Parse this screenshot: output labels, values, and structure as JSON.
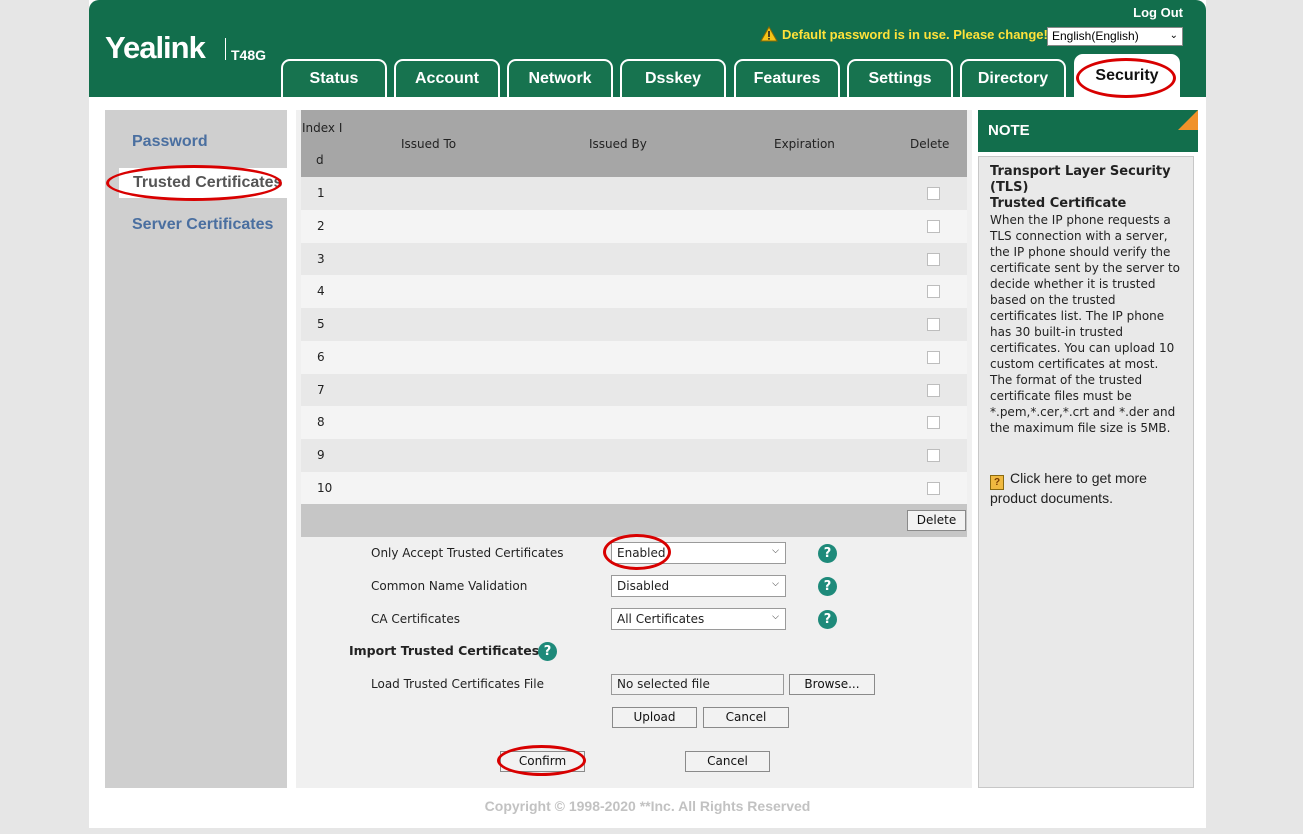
{
  "header": {
    "logo": "Yealink",
    "model": "T48G",
    "logout": "Log Out",
    "warning": "Default password is in use. Please change!",
    "language": "English(English)"
  },
  "tabs": [
    {
      "label": "Status"
    },
    {
      "label": "Account"
    },
    {
      "label": "Network"
    },
    {
      "label": "Dsskey"
    },
    {
      "label": "Features"
    },
    {
      "label": "Settings"
    },
    {
      "label": "Directory"
    },
    {
      "label": "Security",
      "active": true
    }
  ],
  "sidebar": {
    "items": [
      {
        "label": "Password"
      },
      {
        "label": "Trusted Certificates",
        "active": true
      },
      {
        "label": "Server Certificates"
      }
    ]
  },
  "table": {
    "headers": {
      "index_line1": "Index I",
      "index_line2": "d",
      "issued_to": "Issued To",
      "issued_by": "Issued By",
      "expiration": "Expiration",
      "delete": "Delete"
    },
    "rows": [
      {
        "index": "1"
      },
      {
        "index": "2"
      },
      {
        "index": "3"
      },
      {
        "index": "4"
      },
      {
        "index": "5"
      },
      {
        "index": "6"
      },
      {
        "index": "7"
      },
      {
        "index": "8"
      },
      {
        "index": "9"
      },
      {
        "index": "10"
      }
    ],
    "delete_button": "Delete"
  },
  "settings": {
    "only_accept": {
      "label": "Only Accept Trusted Certificates",
      "value": "Enabled"
    },
    "cn_validation": {
      "label": "Common Name Validation",
      "value": "Disabled"
    },
    "ca_certificates": {
      "label": "CA Certificates",
      "value": "All Certificates"
    },
    "import_title": "Import Trusted Certificates",
    "load_label": "Load Trusted Certificates File",
    "file_value": "No selected file",
    "browse": "Browse...",
    "upload": "Upload",
    "cancel_upload": "Cancel",
    "confirm": "Confirm",
    "cancel": "Cancel"
  },
  "note": {
    "heading": "NOTE",
    "title": "Transport Layer Security (TLS)",
    "subtitle": "Trusted Certificate",
    "body": "When the IP phone requests a TLS connection with a server, the IP phone should verify the certificate sent by the server to decide whether it is trusted based on the trusted certificates list. The IP phone has 30 built-in trusted certificates. You can upload 10 custom certificates at most. The format of the trusted certificate files must be *.pem,*.cer,*.crt and *.der and the maximum file size is 5MB.",
    "docs_link": "Click here to get more product documents."
  },
  "footer": "Copyright © 1998-2020 **Inc. All Rights Reserved",
  "colors": {
    "brand": "#126e4c",
    "highlight": "#d80000",
    "link": "#4a6fa0"
  }
}
